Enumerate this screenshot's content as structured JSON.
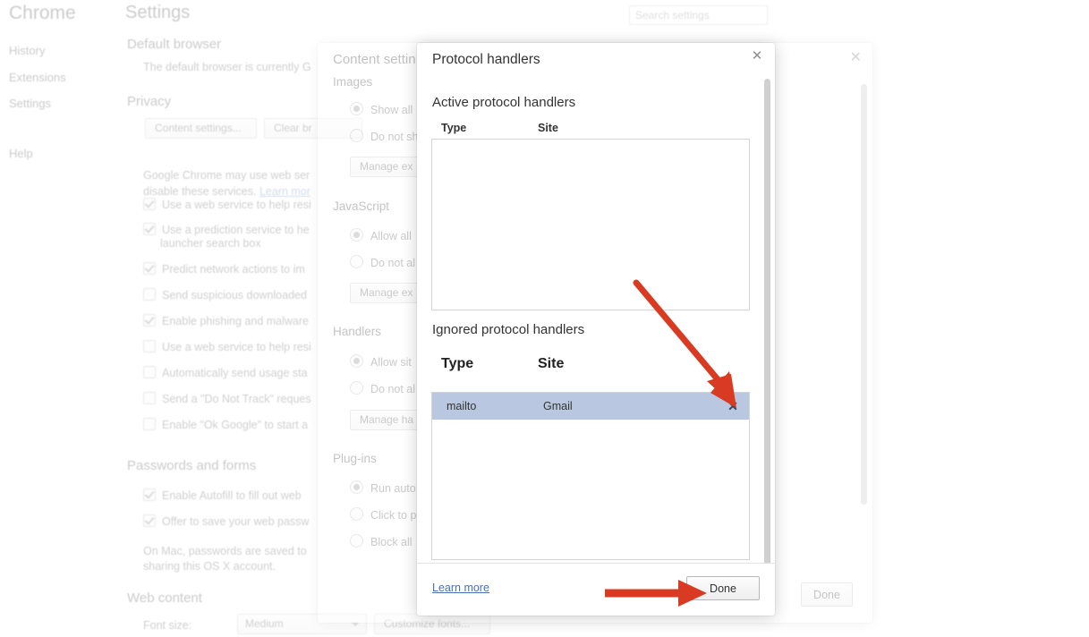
{
  "background": {
    "brand": "Chrome",
    "nav": [
      {
        "label": "History"
      },
      {
        "label": "Extensions"
      },
      {
        "label": "Settings"
      },
      {
        "label": "Help"
      }
    ],
    "page_title": "Settings",
    "search_placeholder": "Search settings",
    "sections": {
      "default_browser": {
        "heading": "Default browser",
        "text": "The default browser is currently G"
      },
      "privacy": {
        "heading": "Privacy",
        "buttons": [
          "Content settings...",
          "Clear br"
        ],
        "note_line1": "Google Chrome may use web ser",
        "note_line2": "disable these services.",
        "note_link": "Learn mor",
        "checkboxes": [
          {
            "label": "Use a web service to help resi",
            "checked": true
          },
          {
            "label": "Use a prediction service to he",
            "label2": "launcher search box",
            "checked": true
          },
          {
            "label": "Predict network actions to im",
            "checked": true
          },
          {
            "label": "Send suspicious downloaded",
            "checked": false
          },
          {
            "label": "Enable phishing and malware",
            "checked": true
          },
          {
            "label": "Use a web service to help resi",
            "checked": false
          },
          {
            "label": "Automatically send usage sta",
            "checked": false
          },
          {
            "label": "Send a \"Do Not Track\" reques",
            "checked": false
          },
          {
            "label": "Enable \"Ok Google\" to start a",
            "checked": false
          }
        ]
      },
      "passwords": {
        "heading": "Passwords and forms",
        "checkboxes": [
          {
            "label": "Enable Autofill to fill out web",
            "checked": true
          },
          {
            "label": "Offer to save your web passw",
            "checked": true
          }
        ],
        "note_line1": "On Mac, passwords are saved to",
        "note_line2": "sharing this OS X account."
      },
      "web_content": {
        "heading": "Web content",
        "font_size_label": "Font size:",
        "font_size_value": "Medium",
        "customize_button": "Customize fonts..."
      }
    }
  },
  "content_settings_dialog": {
    "title": "Content settin",
    "close_icon": "close-icon",
    "done_label": "Done",
    "sections": [
      {
        "heading": "Images",
        "options": [
          {
            "label": "Show all",
            "selected": true
          },
          {
            "label": "Do not sh",
            "selected": false
          }
        ],
        "manage_button": "Manage ex"
      },
      {
        "heading": "JavaScript",
        "options": [
          {
            "label": "Allow all",
            "selected": true
          },
          {
            "label": "Do not al",
            "selected": false
          }
        ],
        "manage_button": "Manage ex"
      },
      {
        "heading": "Handlers",
        "options": [
          {
            "label": "Allow sit",
            "selected": true
          },
          {
            "label": "Do not al",
            "selected": false
          }
        ],
        "manage_button": "Manage ha"
      },
      {
        "heading": "Plug-ins",
        "options": [
          {
            "label": "Run auto",
            "selected": true
          },
          {
            "label": "Click to p",
            "selected": false
          },
          {
            "label": "Block all",
            "selected": false
          }
        ],
        "manage_button": ""
      }
    ]
  },
  "protocol_dialog": {
    "title": "Protocol handlers",
    "close_icon": "close-icon",
    "active": {
      "heading": "Active protocol handlers",
      "columns": {
        "type": "Type",
        "site": "Site"
      },
      "rows": []
    },
    "ignored": {
      "heading": "Ignored protocol handlers",
      "columns": {
        "type": "Type",
        "site": "Site"
      },
      "rows": [
        {
          "type": "mailto",
          "site": "Gmail",
          "selected": true,
          "remove_icon": "close-icon"
        }
      ]
    },
    "footer": {
      "learn_more": "Learn more",
      "done_label": "Done"
    }
  },
  "annotations": {
    "arrow_color": "#d93b22",
    "arrows": [
      {
        "name": "arrow-to-remove-handler",
        "target": "remove-handler-icon"
      },
      {
        "name": "arrow-to-done-button",
        "target": "protocol-done-button"
      }
    ]
  }
}
